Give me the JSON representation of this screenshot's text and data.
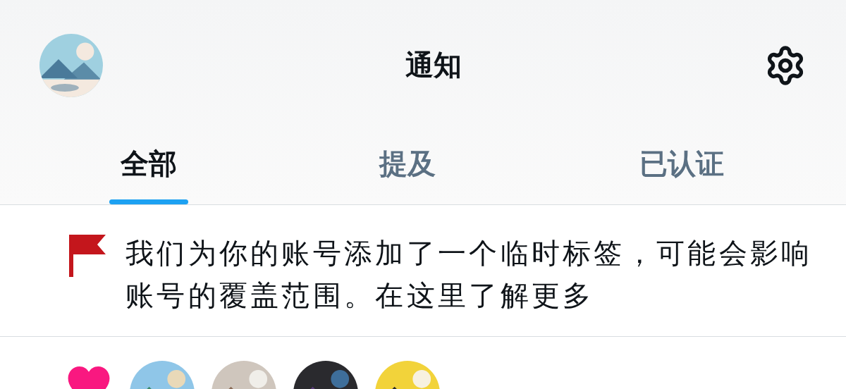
{
  "header": {
    "title": "通知"
  },
  "tabs": [
    {
      "label": "全部",
      "selected": true
    },
    {
      "label": "提及",
      "selected": false
    },
    {
      "label": "已认证",
      "selected": false
    }
  ],
  "notifications": [
    {
      "kind": "flag",
      "text": "我们为你的账号添加了一个临时标签，可能会影响账号的覆盖范围。在这里了解更多"
    },
    {
      "kind": "like"
    }
  ]
}
